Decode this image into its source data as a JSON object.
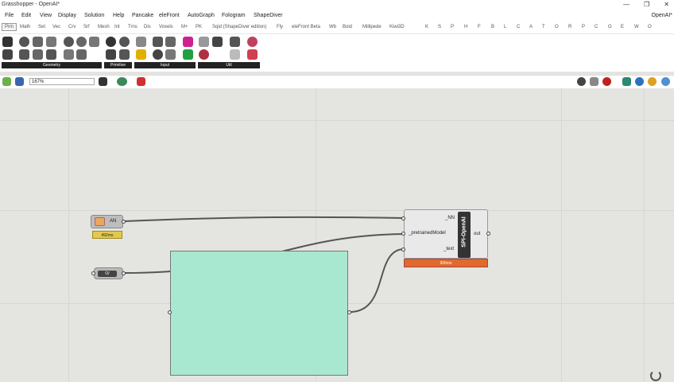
{
  "window": {
    "title": "Grasshopper - OpenAI*",
    "right_label": "OpenAI*",
    "controls": [
      "—",
      "❐",
      "✕"
    ]
  },
  "menu": [
    "File",
    "Edit",
    "View",
    "Display",
    "Solution",
    "Help",
    "Pancake",
    "eleFront",
    "AutoGraph",
    "Fologram",
    "ShapeDiver"
  ],
  "tabs": [
    "Prm",
    "Math",
    "Set",
    "Vec",
    "Crv",
    "Srf",
    "Mesh",
    "Int",
    "Trns",
    "Dis",
    "Voxels",
    "M+",
    "PK",
    "Sqid (ShapeDiver edition)",
    "Fly",
    "eleFront Beta",
    "Wb",
    "Boid",
    "Millipede",
    "Kiwi3D",
    "K",
    "S",
    "P",
    "H",
    "F",
    "B",
    "L",
    "C",
    "A",
    "T",
    "O",
    "R",
    "P",
    "C",
    "G",
    "E",
    "W",
    "O"
  ],
  "active_tab": "Prm",
  "ribbon_groups": [
    "Geometry",
    "Primitive",
    "Input",
    "Util"
  ],
  "canvas_toolbar": {
    "zoom": "167%"
  },
  "colors": {
    "panel": "#a8e8d0",
    "timer": "#e06a2c",
    "yellow": "#e3c94a"
  },
  "canvas": {
    "param_api": {
      "label": "AN",
      "time": "492ms"
    },
    "toggle": {
      "label": "O/"
    },
    "component": {
      "name": "SPI-OpenAI",
      "inputs": [
        "_NN",
        "_pretrainedModel",
        "_text"
      ],
      "output": "out",
      "time": "906ms"
    }
  }
}
